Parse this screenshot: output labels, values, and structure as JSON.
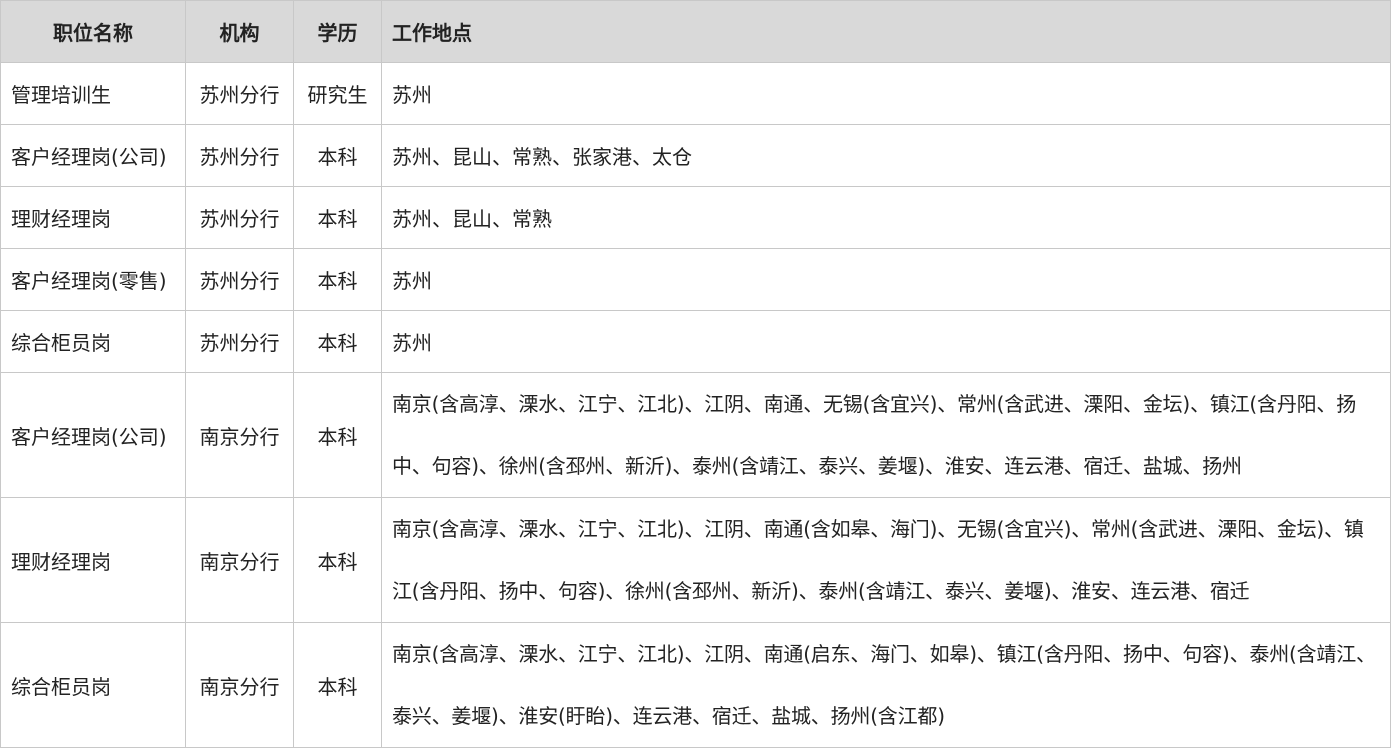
{
  "table": {
    "headers": {
      "position": "职位名称",
      "org": "机构",
      "education": "学历",
      "location": "工作地点"
    },
    "rows": [
      {
        "position": "管理培训生",
        "org": "苏州分行",
        "education": "研究生",
        "location": "苏州"
      },
      {
        "position": "客户经理岗(公司)",
        "org": "苏州分行",
        "education": "本科",
        "location": "苏州、昆山、常熟、张家港、太仓"
      },
      {
        "position": "理财经理岗",
        "org": "苏州分行",
        "education": "本科",
        "location": "苏州、昆山、常熟"
      },
      {
        "position": "客户经理岗(零售)",
        "org": "苏州分行",
        "education": "本科",
        "location": "苏州"
      },
      {
        "position": "综合柜员岗",
        "org": "苏州分行",
        "education": "本科",
        "location": "苏州"
      },
      {
        "position": "客户经理岗(公司)",
        "org": "南京分行",
        "education": "本科",
        "location": "南京(含高淳、溧水、江宁、江北)、江阴、南通、无锡(含宜兴)、常州(含武进、溧阳、金坛)、镇江(含丹阳、扬中、句容)、徐州(含邳州、新沂)、泰州(含靖江、泰兴、姜堰)、淮安、连云港、宿迁、盐城、扬州"
      },
      {
        "position": "理财经理岗",
        "org": "南京分行",
        "education": "本科",
        "location": "南京(含高淳、溧水、江宁、江北)、江阴、南通(含如皋、海门)、无锡(含宜兴)、常州(含武进、溧阳、金坛)、镇江(含丹阳、扬中、句容)、徐州(含邳州、新沂)、泰州(含靖江、泰兴、姜堰)、淮安、连云港、宿迁"
      },
      {
        "position": "综合柜员岗",
        "org": "南京分行",
        "education": "本科",
        "location": "南京(含高淳、溧水、江宁、江北)、江阴、南通(启东、海门、如皋)、镇江(含丹阳、扬中、句容)、泰州(含靖江、泰兴、姜堰)、淮安(盱眙)、连云港、宿迁、盐城、扬州(含江都)"
      }
    ]
  }
}
